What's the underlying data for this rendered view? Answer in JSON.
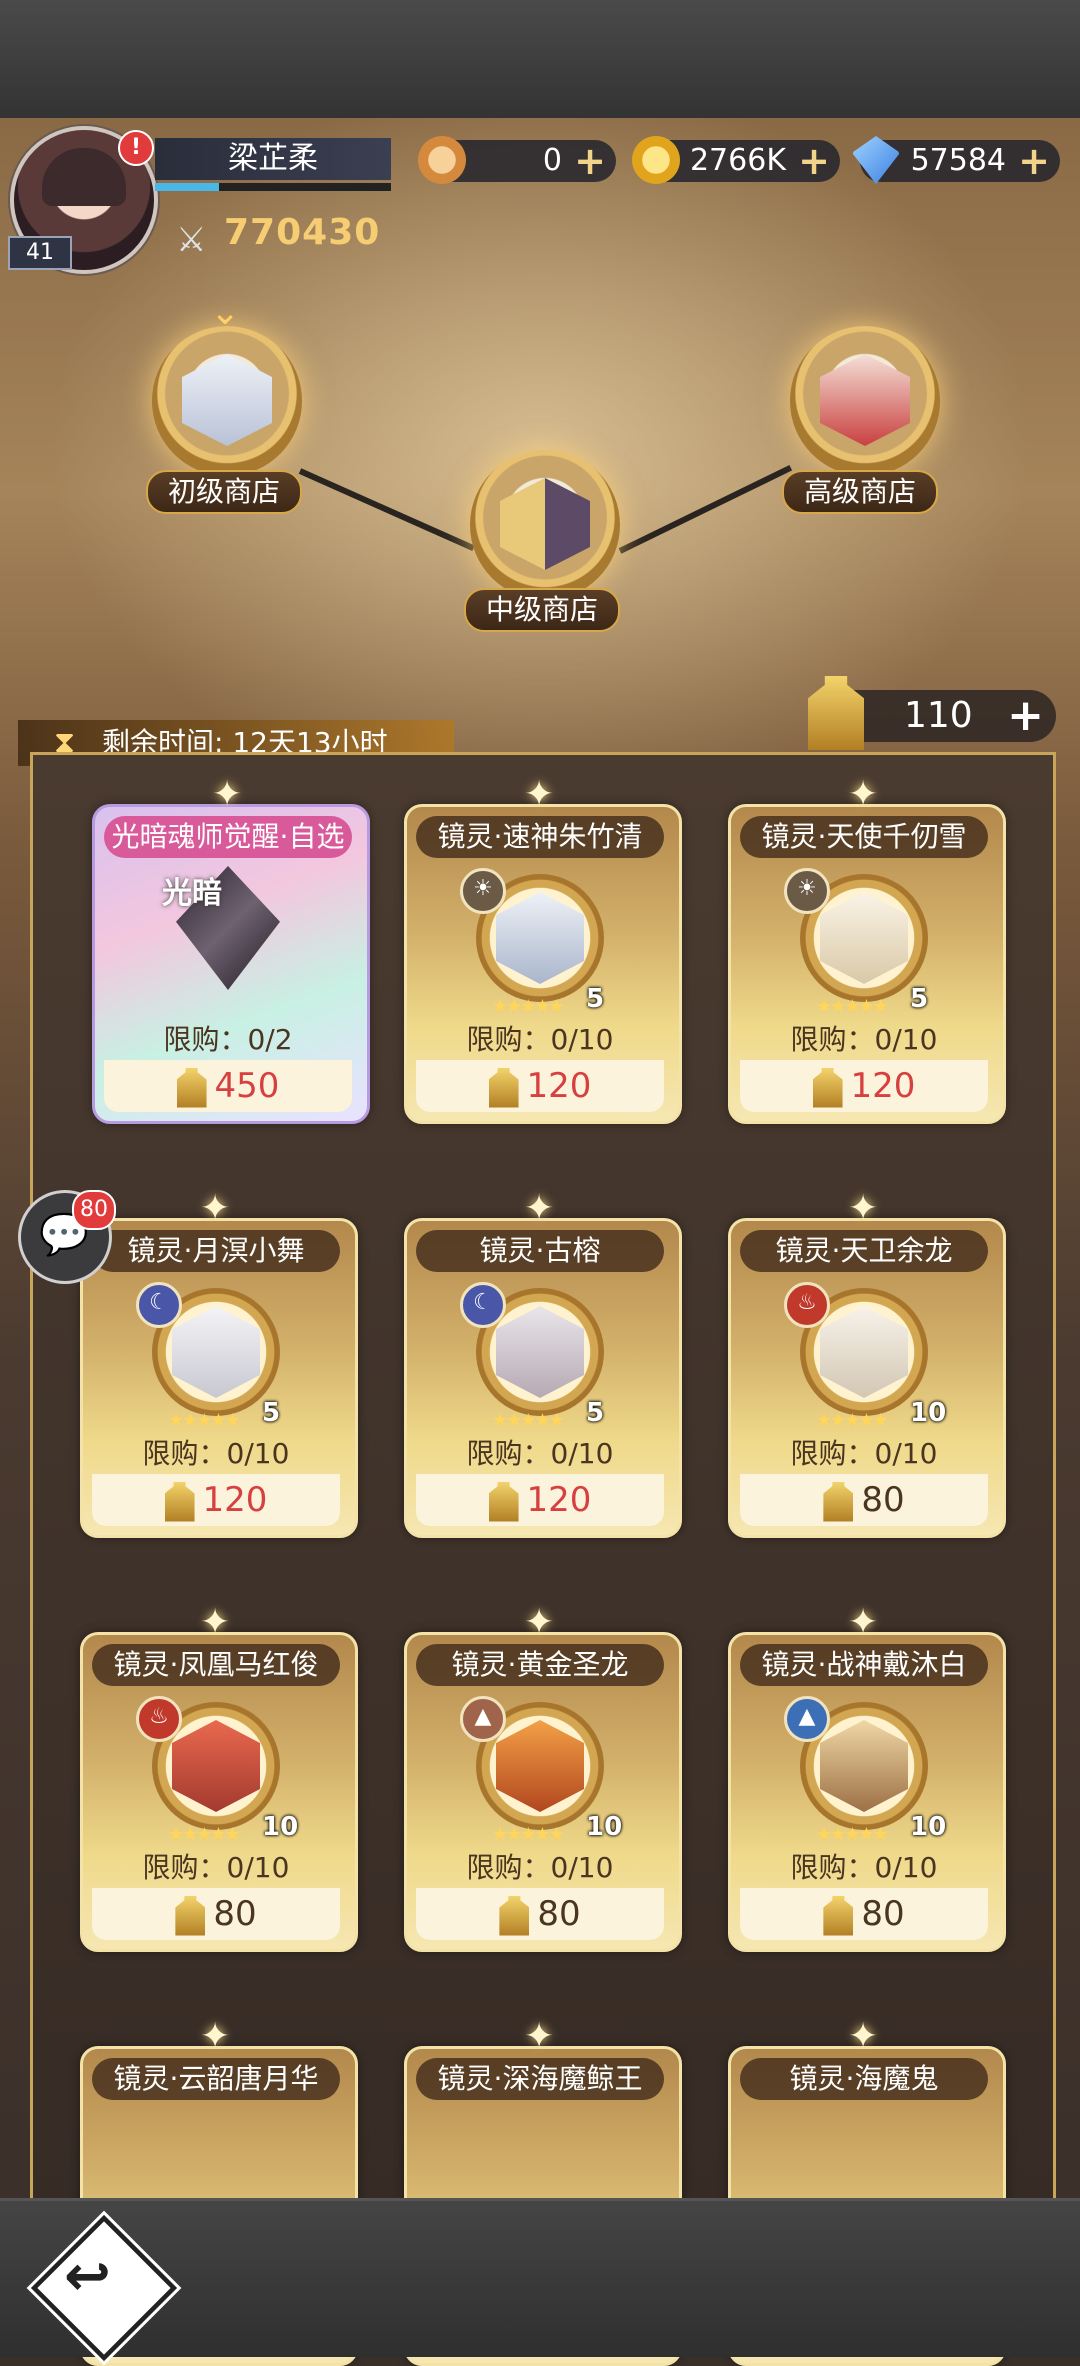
{
  "player": {
    "name": "梁芷柔",
    "level": "41",
    "power": "770430",
    "exp_progress": 0.27
  },
  "currencies": [
    {
      "name": "coupon",
      "value": "0",
      "color": "#e8a85a"
    },
    {
      "name": "gold",
      "value": "2766K",
      "color": "#f2c23c"
    },
    {
      "name": "diamond",
      "value": "57584",
      "color": "#5fa8f5"
    }
  ],
  "shops": {
    "basic": "初级商店",
    "middle": "中级商店",
    "advanced": "高级商店"
  },
  "timer": {
    "label": "剩余时间: 12天13小时"
  },
  "tokens": {
    "value": "110",
    "plus": "+"
  },
  "chat": {
    "badge": "80"
  },
  "items": [
    {
      "title": "光暗魂师觉醒·自选",
      "limit": "限购：0/2",
      "price": "450",
      "featured": true,
      "crystal": "光暗"
    },
    {
      "title": "镜灵·速神朱竹清",
      "limit": "限购：0/10",
      "price": "120",
      "count": "5",
      "attr": "☀"
    },
    {
      "title": "镜灵·天使千仞雪",
      "limit": "限购：0/10",
      "price": "120",
      "count": "5",
      "attr": "☀"
    },
    {
      "title": "镜灵·月溟小舞",
      "limit": "限购：0/10",
      "price": "120",
      "count": "5",
      "attr": "☾"
    },
    {
      "title": "镜灵·古榕",
      "limit": "限购：0/10",
      "price": "120",
      "count": "5",
      "attr": "☾"
    },
    {
      "title": "镜灵·天卫余龙",
      "limit": "限购：0/10",
      "price": "80",
      "count": "10",
      "attr": "♨"
    },
    {
      "title": "镜灵·凤凰马红俊",
      "limit": "限购：0/10",
      "price": "80",
      "count": "10",
      "attr": "♨"
    },
    {
      "title": "镜灵·黄金圣龙",
      "limit": "限购：0/10",
      "price": "80",
      "count": "10",
      "attr": "▲"
    },
    {
      "title": "镜灵·战神戴沐白",
      "limit": "限购：0/10",
      "price": "80",
      "count": "10",
      "attr": "▲"
    },
    {
      "title": "镜灵·云韶唐月华",
      "limit": "",
      "price": "",
      "count": "",
      "attr": "▲"
    },
    {
      "title": "镜灵·深海魔鲸王",
      "limit": "",
      "price": "",
      "count": "",
      "attr": "▲"
    },
    {
      "title": "镜灵·海魔鬼",
      "limit": "",
      "price": "",
      "count": "",
      "attr": "▲"
    }
  ]
}
